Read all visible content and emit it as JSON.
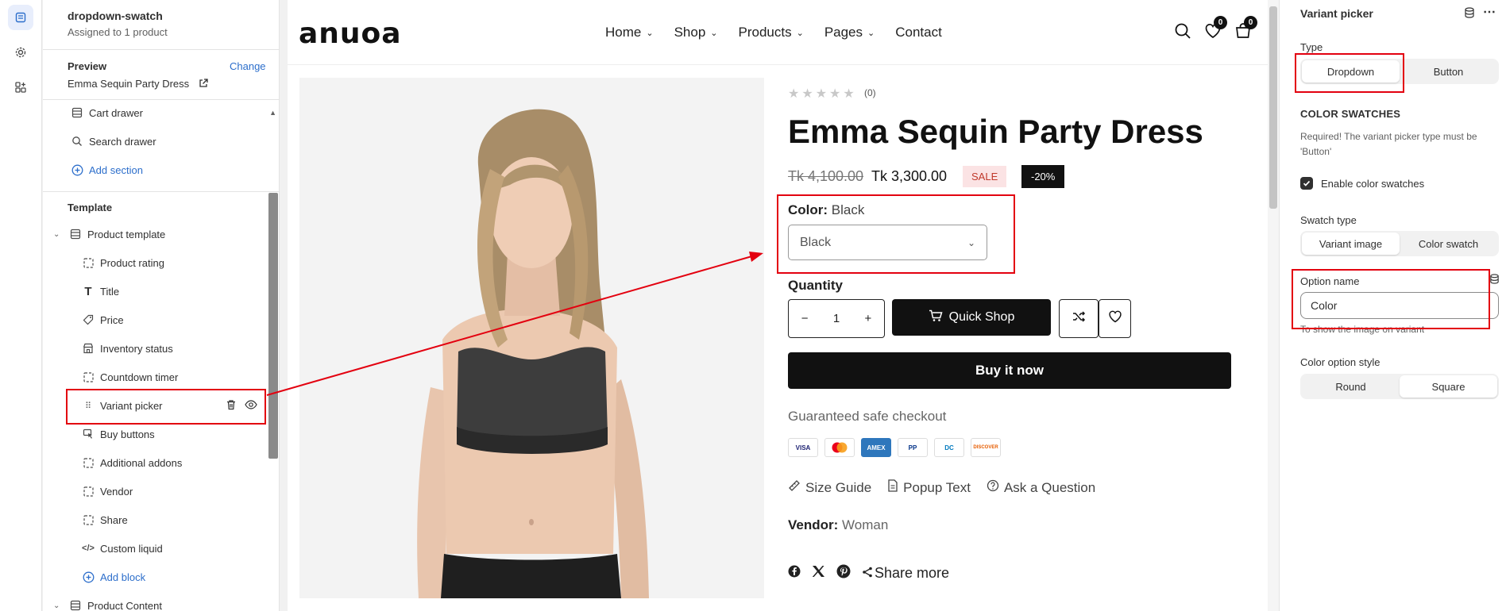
{
  "sidebar_left": {
    "theme_name": "dropdown-swatch",
    "theme_sub": "Assigned to 1 product",
    "preview_label": "Preview",
    "change_link": "Change",
    "preview_value": "Emma Sequin Party Dress",
    "header_items": [
      {
        "label": "Cart drawer",
        "icon": "layout-icon"
      },
      {
        "label": "Search drawer",
        "icon": "search-icon"
      },
      {
        "label": "Add section",
        "icon": "plus-circle-icon"
      }
    ],
    "template_label": "Template",
    "product_template": "Product template",
    "blocks": [
      {
        "label": "Product rating",
        "icon": "dashed-square-icon"
      },
      {
        "label": "Title",
        "icon": "text-icon"
      },
      {
        "label": "Price",
        "icon": "price-tag-icon"
      },
      {
        "label": "Inventory status",
        "icon": "store-icon"
      },
      {
        "label": "Countdown timer",
        "icon": "dashed-square-icon"
      },
      {
        "label": "Variant picker",
        "icon": "drag-handle-icon"
      },
      {
        "label": "Buy buttons",
        "icon": "cursor-icon"
      },
      {
        "label": "Additional addons",
        "icon": "dashed-square-icon"
      },
      {
        "label": "Vendor",
        "icon": "dashed-square-icon"
      },
      {
        "label": "Share",
        "icon": "dashed-square-icon"
      },
      {
        "label": "Custom liquid",
        "icon": "code-icon"
      }
    ],
    "add_block": "Add block",
    "product_content": "Product Content"
  },
  "store": {
    "logo": "anuoa",
    "nav": [
      "Home",
      "Shop",
      "Products",
      "Pages",
      "Contact"
    ],
    "wishlist_count": "0",
    "cart_count": "0"
  },
  "product": {
    "stars": "★★★★★",
    "rating_count": "(0)",
    "title": "Emma Sequin Party Dress",
    "old_price": "Tk 4,100.00",
    "new_price": "Tk 3,300.00",
    "sale_badge": "SALE",
    "discount_badge": "-20%",
    "color_label": "Color:",
    "color_value": "Black",
    "select_value": "Black",
    "quantity_label": "Quantity",
    "quantity": "1",
    "quick_shop": "Quick Shop",
    "buy_now": "Buy it now",
    "safe_checkout": "Guaranteed safe checkout",
    "payments": [
      "VISA",
      "MC",
      "AMEX",
      "PP",
      "DC",
      "DISCOVER"
    ],
    "links": [
      "Size Guide",
      "Popup Text",
      "Ask a Question"
    ],
    "vendor_label": "Vendor:",
    "vendor_value": "Woman",
    "share_more": "Share more"
  },
  "settings": {
    "title": "Variant picker",
    "type_label": "Type",
    "type_options": [
      "Dropdown",
      "Button"
    ],
    "type_selected": "Dropdown",
    "swatches_heading": "COLOR SWATCHES",
    "swatches_help": "Required! The variant picker type must be 'Button'",
    "enable_swatches": "Enable color swatches",
    "swatch_type_label": "Swatch type",
    "swatch_type_options": [
      "Variant image",
      "Color swatch"
    ],
    "option_name_label": "Option name",
    "option_name_value": "Color",
    "option_name_help": "To show the image on variant",
    "color_style_label": "Color option style",
    "color_style_options": [
      "Round",
      "Square"
    ],
    "color_style_selected": "Square"
  }
}
